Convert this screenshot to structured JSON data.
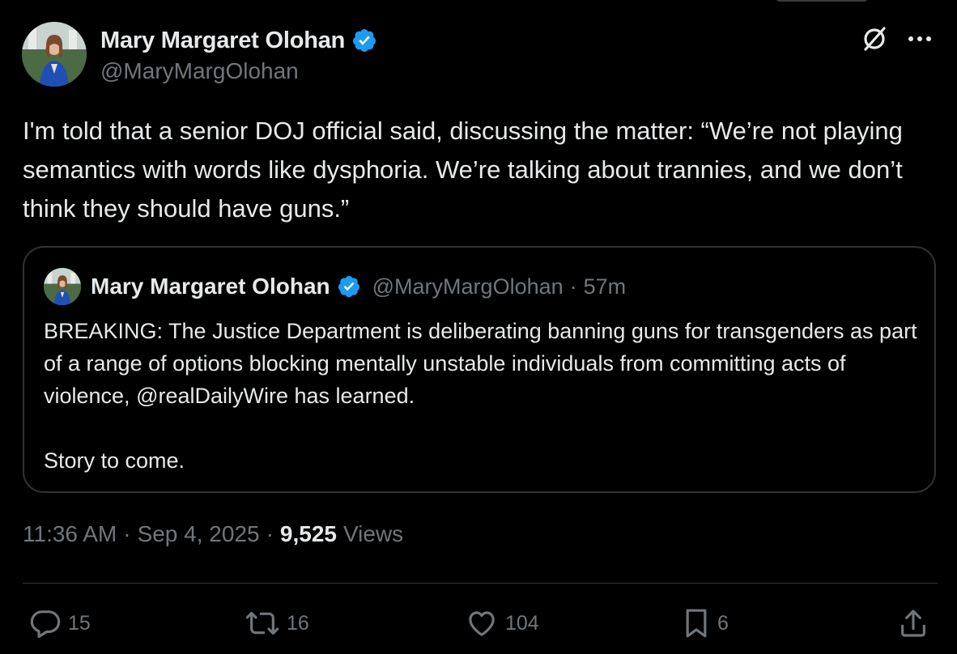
{
  "author": {
    "display_name": "Mary Margaret Olohan",
    "handle": "@MaryMargOlohan"
  },
  "tweet": {
    "text": "I'm told that a senior DOJ official said, discussing the matter: “We’re not playing semantics with words like dysphoria. We’re talking about trannies, and we don’t think they should have guns.”"
  },
  "quote": {
    "display_name": "Mary Margaret Olohan",
    "handle": "@MaryMargOlohan",
    "separator": "·",
    "time": "57m",
    "paragraph_1": "BREAKING: The Justice Department is deliberating banning guns for transgenders as part of a range of options blocking mentally unstable individuals from committing acts of violence, @realDailyWire has learned.",
    "paragraph_2": "Story to come."
  },
  "meta": {
    "time": "11:36 AM",
    "sep1": "·",
    "date": "Sep 4, 2025",
    "sep2": "·",
    "views_count": "9,525",
    "views_label": "Views"
  },
  "actions": {
    "reply_count": "15",
    "retweet_count": "16",
    "like_count": "104",
    "bookmark_count": "6"
  },
  "icons": {
    "verified": "verified-badge-icon",
    "grok": "grok-icon",
    "more": "more-icon",
    "reply": "reply-icon",
    "retweet": "retweet-icon",
    "like": "heart-icon",
    "bookmark": "bookmark-icon",
    "share": "share-icon"
  },
  "colors": {
    "background": "#000000",
    "text": "#e7e9ea",
    "secondary": "#71767b",
    "verified": "#1d9bf0",
    "border": "#2f3336"
  }
}
